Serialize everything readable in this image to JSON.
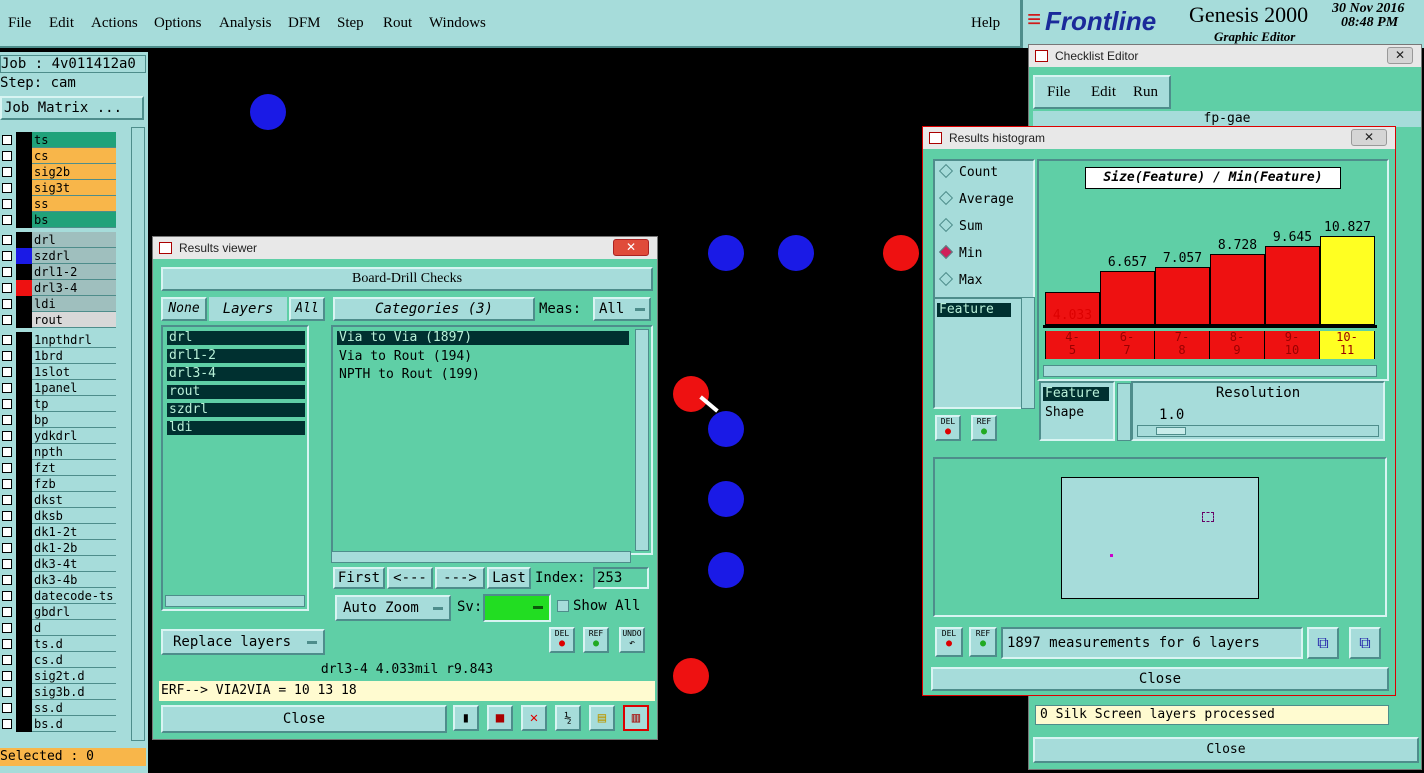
{
  "menu": [
    "File",
    "Edit",
    "Actions",
    "Options",
    "Analysis",
    "DFM",
    "Step",
    "Rout",
    "Windows"
  ],
  "help": "Help",
  "brand": {
    "logo": "Frontline",
    "product": "Genesis 2000",
    "subtitle": "Graphic Editor",
    "date": "30 Nov 2016",
    "time": "08:48 PM"
  },
  "left": {
    "job": "Job : 4v011412a0",
    "step": "Step: cam",
    "matrix_button": "Job Matrix ...",
    "selected": "Selected : 0",
    "layers_top": [
      {
        "name": "ts",
        "color": "#20a27a"
      },
      {
        "name": "cs",
        "color": "#f8b64a"
      },
      {
        "name": "sig2b",
        "color": "#f8b64a"
      },
      {
        "name": "sig3t",
        "color": "#f8b64a"
      },
      {
        "name": "ss",
        "color": "#f8b64a"
      },
      {
        "name": "bs",
        "color": "#20a27a"
      }
    ],
    "layers_drill": [
      {
        "name": "drl",
        "color": "#9fbfbe"
      },
      {
        "name": "szdrl",
        "color": "#9fbfbe"
      },
      {
        "name": "drl1-2",
        "color": "#9fbfbe"
      },
      {
        "name": "drl3-4",
        "color": "#9fbfbe"
      },
      {
        "name": "ldi",
        "color": "#9fbfbe"
      },
      {
        "name": "rout",
        "color": "#d8d8d8"
      }
    ],
    "layers_misc": [
      "1npthdrl",
      "1brd",
      "1slot",
      "1panel",
      "tp",
      "bp",
      "ydkdrl",
      "npth",
      "fzt",
      "fzb",
      "dkst",
      "dksb",
      "dk1-2t",
      "dk1-2b",
      "dk3-4t",
      "dk3-4b",
      "datecode-ts",
      "gbdrl",
      "d",
      "ts.d",
      "cs.d",
      "sig2t.d",
      "sig3b.d",
      "ss.d",
      "bs.d"
    ]
  },
  "results_viewer": {
    "title": "Results viewer",
    "close_x": "✕",
    "header": "Board-Drill Checks",
    "none_btn": "None",
    "layers_label": "Layers",
    "all_btn": "All",
    "layers": [
      "drl",
      "drl1-2",
      "drl3-4",
      "rout",
      "szdrl",
      "ldi"
    ],
    "categories_label": "Categories (3)",
    "meas_label": "Meas:",
    "meas_value": "All",
    "categories": [
      "Via to Via  (1897)",
      "Via to Rout  (194)",
      "NPTH to Rout  (199)"
    ],
    "first": "First",
    "prev": "<---",
    "next": "--->",
    "last": "Last",
    "index_label": "Index:",
    "index_value": "253",
    "auto_zoom": "Auto Zoom",
    "sv_label": "Sv:",
    "show_all": "Show All",
    "replace_layers": "Replace layers",
    "del": "DEL",
    "ref": "REF",
    "undo": "UNDO",
    "status": "drl3-4 4.033mil  r9.843",
    "erf": "ERF--> VIA2VIA = 10 13 18",
    "close": "Close"
  },
  "checklist_editor": {
    "title": "Checklist Editor",
    "close_x": "✕",
    "menu": [
      "File",
      "Edit",
      "Run"
    ],
    "name": "fp-gae",
    "status": "0 Silk Screen layers processed",
    "close": "Close"
  },
  "histogram": {
    "title": "Results histogram",
    "close_x": "✕",
    "modes": [
      "Count",
      "Average",
      "Sum",
      "Min",
      "Max"
    ],
    "selected_mode": "Min",
    "feature_label": "Feature",
    "chart_title": "Size(Feature) / Min(Feature)",
    "bins": [
      "4-5",
      "6-7",
      "7-8",
      "8-9",
      "9-10",
      "10-11"
    ],
    "values": [
      4.033,
      6.657,
      7.057,
      8.728,
      9.645,
      10.827
    ],
    "value_labels": [
      "4.033",
      "6.657",
      "7.057",
      "8.728",
      "9.645",
      "10.827"
    ],
    "bin_text": [
      [
        "4-",
        "5"
      ],
      [
        "6-",
        "7"
      ],
      [
        "7-",
        "8"
      ],
      [
        "8-",
        "9"
      ],
      [
        "9-",
        "10"
      ],
      [
        "10-",
        "11"
      ]
    ],
    "highlight_bin": 5,
    "bar_color": "#ee1111",
    "highlight_color": "#ffff22",
    "attr_items": [
      "Feature",
      "Shape"
    ],
    "resolution_label": "Resolution",
    "resolution_value": "1.0",
    "measurements": "1897 measurements for 6 layers",
    "close": "Close",
    "del": "DEL",
    "ref": "REF"
  }
}
